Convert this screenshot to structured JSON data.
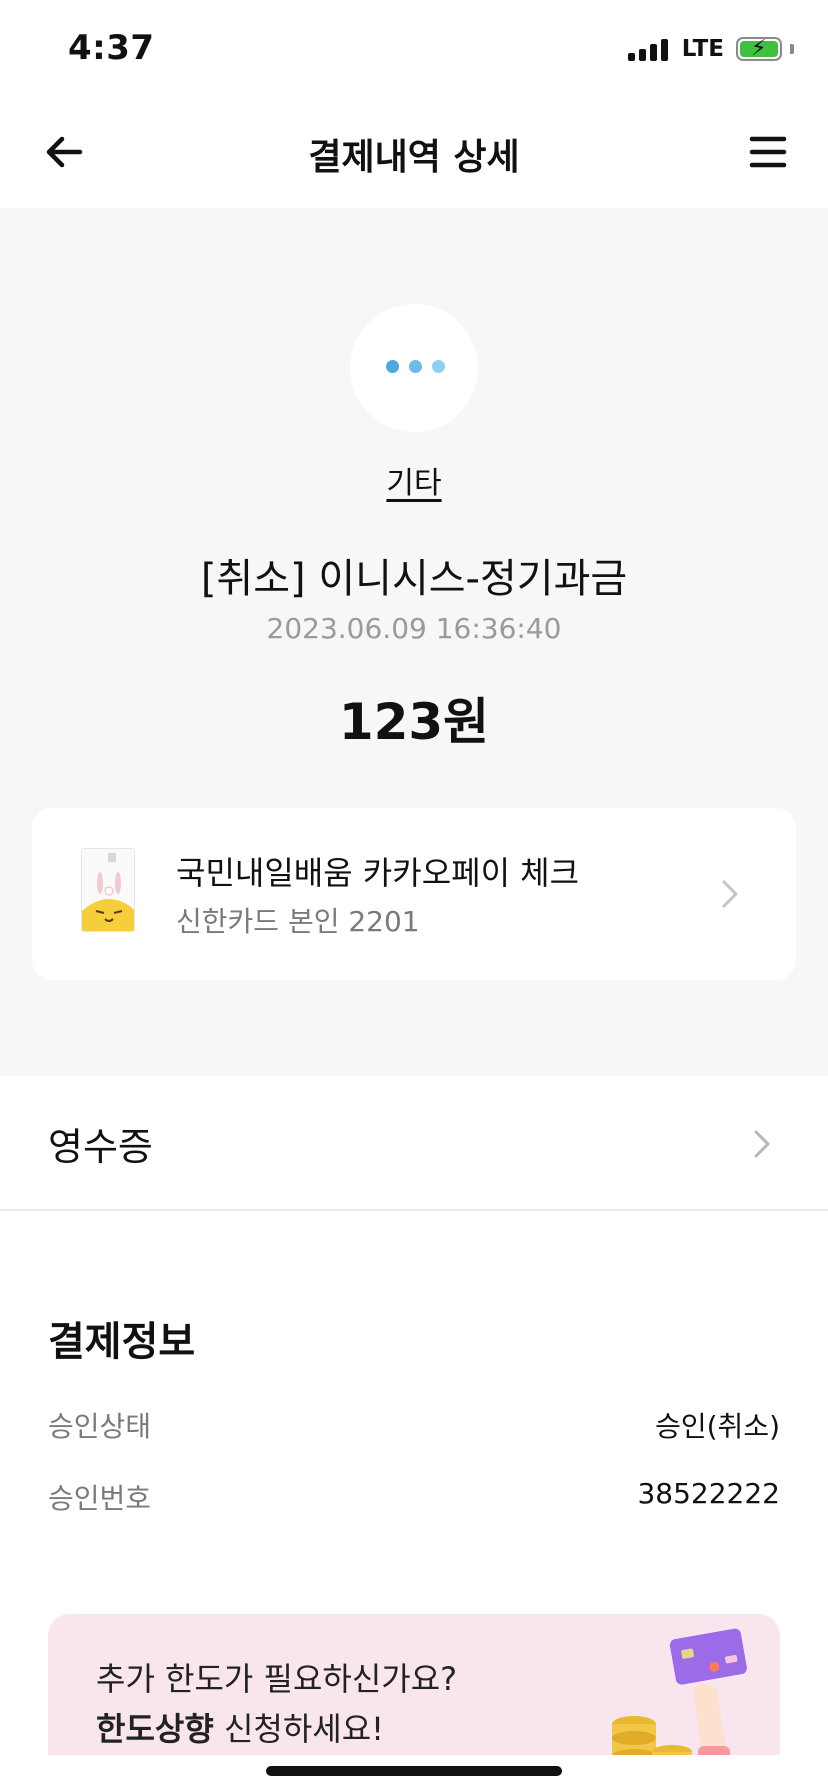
{
  "status_bar": {
    "time": "4:37",
    "network": "LTE",
    "battery_color": "#3ec13e"
  },
  "nav": {
    "title": "결제내역 상세",
    "back_icon": "arrow-left-icon",
    "menu_icon": "hamburger-menu-icon"
  },
  "summary": {
    "category_icon": "more-dots-icon",
    "dot_colors": [
      "#4fa8e0",
      "#6dbbe8",
      "#8fd0f0"
    ],
    "category": "기타",
    "merchant": "[취소] 이니시스-정기과금",
    "datetime": "2023.06.09 16:36:40",
    "amount": "123원"
  },
  "card": {
    "name": "국민내일배움 카카오페이 체크",
    "detail": "신한카드 본인 2201",
    "chevron_icon": "chevron-right-icon"
  },
  "receipt": {
    "label": "영수증",
    "chevron_icon": "chevron-right-icon"
  },
  "payment_info": {
    "title": "결제정보",
    "rows": [
      {
        "label": "승인상태",
        "value": "승인(취소)"
      },
      {
        "label": "승인번호",
        "value": "38522222"
      }
    ]
  },
  "banner": {
    "line1": "추가 한도가 필요하신가요?",
    "line2_bold": "한도상향",
    "line2_rest": " 신청하세요!",
    "background": "#f8e5ee"
  }
}
